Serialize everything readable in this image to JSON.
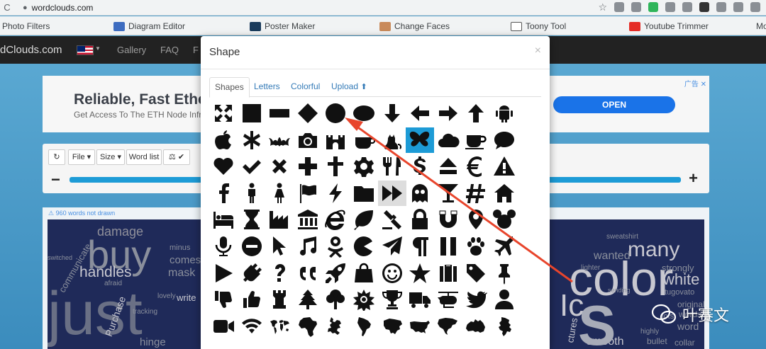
{
  "browser": {
    "url": "wordclouds.com",
    "bookmarks": [
      "Photo Filters",
      "Diagram Editor",
      "Poster Maker",
      "Change Faces",
      "Toony Tool",
      "Youtube Trimmer",
      "Mo"
    ]
  },
  "site": {
    "brand": "dClouds.com",
    "nav": [
      "Gallery",
      "FAQ",
      "F"
    ]
  },
  "ad": {
    "title": "Reliable, Fast Ethe",
    "subtitle": "Get Access To The ETH Node Infra",
    "button": "OPEN",
    "corner": "广告 ✕"
  },
  "toolbar": {
    "buttons": [
      "File ▾",
      "Size ▾",
      "Word list",
      "⚖ ✔"
    ]
  },
  "cloud": {
    "note": "⚠ 960 words not drawn",
    "words_left": [
      "damage",
      "buy",
      "communicate",
      "handles",
      "mask",
      "comes",
      "minus",
      "afraid",
      "just",
      "write",
      "Purchase",
      "hinge",
      "lovely",
      "switched",
      "tracking"
    ],
    "words_right": [
      "many",
      "color",
      "wanted",
      "sweatshirt",
      "white",
      "strongly",
      "lighter",
      "tugovato",
      "sending",
      "smooth",
      "original",
      "highly",
      "words",
      "word",
      "ctures",
      "bullet",
      "lots",
      "collar",
      "Ic"
    ]
  },
  "modal": {
    "title": "Shape",
    "close": "×",
    "tabs": [
      "Shapes",
      "Letters",
      "Colorful",
      "Upload"
    ],
    "active_tab": "Shapes",
    "selected_shape": "butterfly",
    "icons": [
      [
        "expand-arrows",
        "square",
        "wide-rectangle",
        "diamond",
        "circle",
        "ellipse",
        "arrow-down",
        "arrow-left",
        "arrow-right",
        "arrow-up",
        "android"
      ],
      [
        "apple",
        "asterisk",
        "bat",
        "camera",
        "castle",
        "cup-paw",
        "cat",
        "butterfly",
        "cloud",
        "coffee-cup",
        "speech-bubble"
      ],
      [
        "heart",
        "check",
        "times",
        "plus",
        "cross",
        "gear",
        "cutlery",
        "dollar",
        "eject",
        "euro",
        "warning"
      ],
      [
        "facebook",
        "male",
        "female",
        "flag",
        "bolt",
        "folder",
        "fast-forward",
        "ghost",
        "martini",
        "hashtag",
        "home"
      ],
      [
        "bed",
        "hourglass",
        "industry",
        "bank",
        "internet-explorer",
        "leaf",
        "gavel",
        "lock",
        "magnet",
        "map-marker",
        "mouse-ears"
      ],
      [
        "microphone",
        "minus-circle",
        "mouse-pointer",
        "music",
        "odnoklassniki",
        "pacman",
        "paper-plane",
        "paragraph",
        "pause",
        "paw",
        "plane"
      ],
      [
        "play",
        "plug",
        "question",
        "quote",
        "rocket",
        "shopping-bag",
        "smile",
        "star",
        "suitcase",
        "tag",
        "thumbtack"
      ],
      [
        "thumbs-down",
        "thumbs-up",
        "rook",
        "tree",
        "tree-round",
        "sunflower",
        "trophy",
        "truck",
        "helicopter",
        "twitter",
        "user"
      ],
      [
        "video",
        "wifi",
        "world-map",
        "africa",
        "europe",
        "south-america",
        "asia",
        "usa",
        "north-america",
        "australia",
        "netherlands"
      ]
    ]
  },
  "watermark": {
    "text": "叶赛文"
  },
  "colors": {
    "accent": "#1d9bd6",
    "arrow": "#e8452c",
    "nav": "#222222"
  }
}
